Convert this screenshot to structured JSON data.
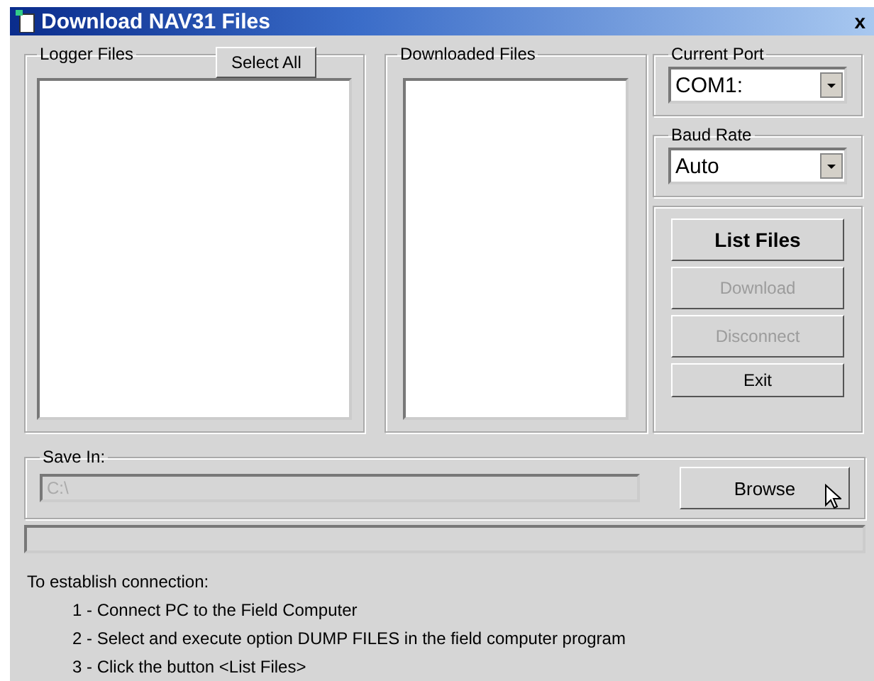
{
  "window": {
    "title": "Download NAV31 Files",
    "close": "x"
  },
  "logger_files": {
    "label": "Logger Files",
    "select_all": "Select All"
  },
  "downloaded_files": {
    "label": "Downloaded Files"
  },
  "current_port": {
    "label": "Current Port",
    "value": "COM1:"
  },
  "baud_rate": {
    "label": "Baud Rate",
    "value": "Auto"
  },
  "actions": [
    {
      "label": "List Files",
      "disabled": false,
      "bold": true
    },
    {
      "label": "Download",
      "disabled": true,
      "bold": false
    },
    {
      "label": "Disconnect",
      "disabled": true,
      "bold": false
    },
    {
      "label": "Exit",
      "disabled": false,
      "bold": false
    }
  ],
  "save_in": {
    "label": "Save In:",
    "value": "C:\\",
    "disabled": true,
    "browse": "Browse"
  },
  "progress": {
    "level": 0
  },
  "instructions": {
    "heading": "To establish connection:",
    "steps": [
      "1 - Connect PC to the Field Computer",
      "2 - Select and execute option DUMP FILES in the field computer program",
      "3 - Click the button <List Files>"
    ]
  }
}
